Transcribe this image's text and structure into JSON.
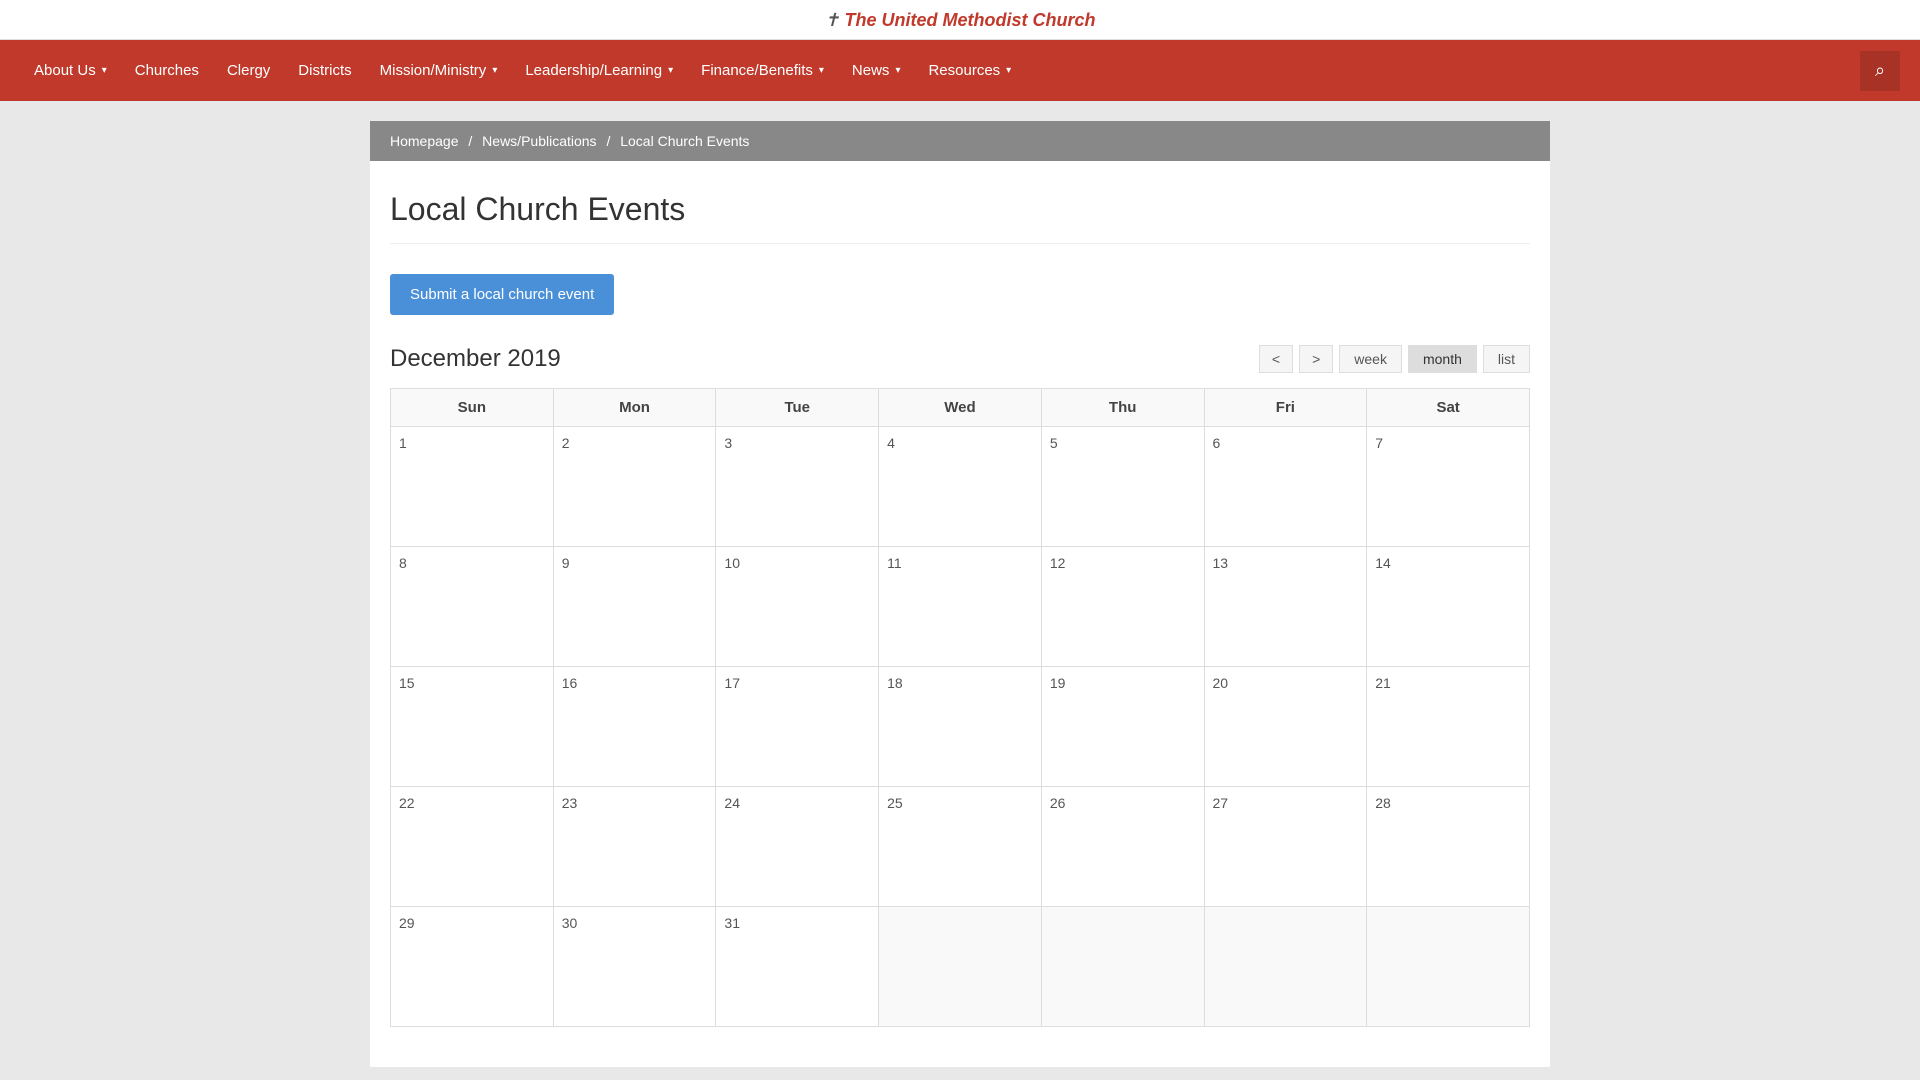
{
  "site": {
    "logo_text": "The United Methodist Church"
  },
  "nav": {
    "items": [
      {
        "label": "About Us",
        "has_dropdown": true
      },
      {
        "label": "Churches",
        "has_dropdown": false
      },
      {
        "label": "Clergy",
        "has_dropdown": false
      },
      {
        "label": "Districts",
        "has_dropdown": false
      },
      {
        "label": "Mission/Ministry",
        "has_dropdown": true
      },
      {
        "label": "Leadership/Learning",
        "has_dropdown": true
      },
      {
        "label": "Finance/Benefits",
        "has_dropdown": true
      },
      {
        "label": "News",
        "has_dropdown": true
      },
      {
        "label": "Resources",
        "has_dropdown": true
      }
    ],
    "search_label": "Search"
  },
  "breadcrumb": {
    "items": [
      {
        "label": "Homepage",
        "href": "#"
      },
      {
        "label": "News/Publications",
        "href": "#"
      },
      {
        "label": "Local Church Events",
        "href": "#"
      }
    ]
  },
  "page": {
    "title": "Local Church Events",
    "submit_button": "Submit a local church event"
  },
  "calendar": {
    "month_year": "December 2019",
    "prev_label": "<",
    "next_label": ">",
    "views": [
      "week",
      "month",
      "list"
    ],
    "active_view": "month",
    "days_of_week": [
      "Sun",
      "Mon",
      "Tue",
      "Wed",
      "Thu",
      "Fri",
      "Sat"
    ],
    "weeks": [
      [
        1,
        2,
        3,
        4,
        5,
        6,
        7
      ],
      [
        8,
        9,
        10,
        11,
        12,
        13,
        14
      ],
      [
        15,
        16,
        17,
        18,
        19,
        20,
        21
      ],
      [
        22,
        23,
        24,
        25,
        26,
        27,
        28
      ],
      [
        29,
        30,
        31,
        null,
        null,
        null,
        null
      ]
    ]
  }
}
